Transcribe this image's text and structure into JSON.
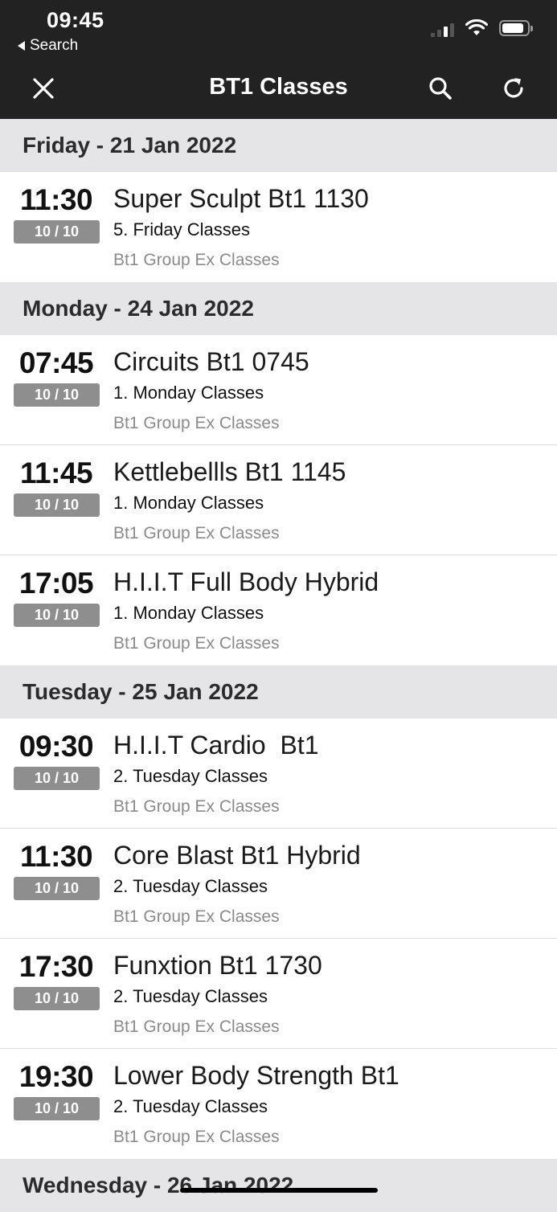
{
  "status": {
    "time": "09:45",
    "back_label": "Search"
  },
  "nav": {
    "title": "BT1 Classes"
  },
  "days": [
    {
      "header": "Friday - 21 Jan 2022",
      "classes": [
        {
          "time": "11:30",
          "capacity": "10 / 10",
          "name": "Super Sculpt Bt1 1130",
          "category": "5. Friday Classes",
          "group": "Bt1 Group Ex Classes"
        }
      ]
    },
    {
      "header": "Monday - 24 Jan 2022",
      "classes": [
        {
          "time": "07:45",
          "capacity": "10 / 10",
          "name": "Circuits Bt1 0745",
          "category": "1. Monday Classes",
          "group": "Bt1 Group Ex Classes"
        },
        {
          "time": "11:45",
          "capacity": "10 / 10",
          "name": "Kettlebellls Bt1 1145",
          "category": "1. Monday Classes",
          "group": "Bt1 Group Ex Classes"
        },
        {
          "time": "17:05",
          "capacity": "10 / 10",
          "name": "H.I.I.T Full Body Hybrid",
          "category": "1. Monday Classes",
          "group": "Bt1 Group Ex Classes"
        }
      ]
    },
    {
      "header": "Tuesday - 25 Jan 2022",
      "classes": [
        {
          "time": "09:30",
          "capacity": "10 / 10",
          "name": "H.I.I.T Cardio  Bt1",
          "category": "2. Tuesday Classes",
          "group": "Bt1 Group Ex Classes"
        },
        {
          "time": "11:30",
          "capacity": "10 / 10",
          "name": "Core Blast Bt1 Hybrid",
          "category": "2. Tuesday Classes",
          "group": "Bt1 Group Ex Classes"
        },
        {
          "time": "17:30",
          "capacity": "10 / 10",
          "name": "Funxtion Bt1 1730",
          "category": "2. Tuesday Classes",
          "group": "Bt1 Group Ex Classes"
        },
        {
          "time": "19:30",
          "capacity": "10 / 10",
          "name": "Lower Body Strength Bt1",
          "category": "2. Tuesday Classes",
          "group": "Bt1 Group Ex Classes"
        }
      ]
    },
    {
      "header": "Wednesday - 26 Jan 2022",
      "classes": []
    }
  ]
}
